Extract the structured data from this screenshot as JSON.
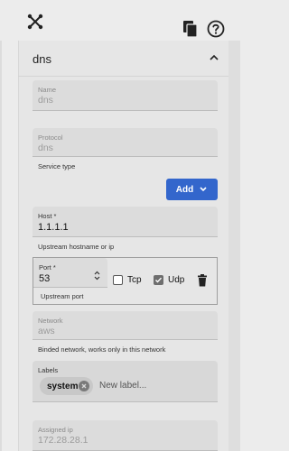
{
  "header": {
    "logo_icon": "network-logo-icon",
    "copy_icon": "copy-icon",
    "help_icon": "help-circle-icon"
  },
  "card": {
    "title": "dns",
    "collapse_icon": "chevron-up-icon"
  },
  "fields": {
    "name": {
      "label": "Name",
      "value": "dns"
    },
    "protocol": {
      "label": "Protocol",
      "value": "dns"
    },
    "service_type_label": "Service type",
    "add_button": "Add",
    "host": {
      "label": "Host *",
      "value": "1.1.1.1",
      "helper": "Upstream hostname or ip"
    },
    "port": {
      "label": "Port *",
      "value": "53",
      "helper": "Upstream port"
    },
    "tcp": {
      "label": "Tcp",
      "checked": false
    },
    "udp": {
      "label": "Udp",
      "checked": true
    },
    "network": {
      "label": "Network",
      "value": "aws",
      "helper": "Binded network, works only in this network"
    },
    "labels": {
      "label": "Labels",
      "chips": [
        "system"
      ],
      "placeholder": "New label..."
    },
    "assigned_ip": {
      "label": "Assigned ip",
      "value": "172.28.28.1"
    }
  },
  "colors": {
    "accent": "#3366cc"
  }
}
